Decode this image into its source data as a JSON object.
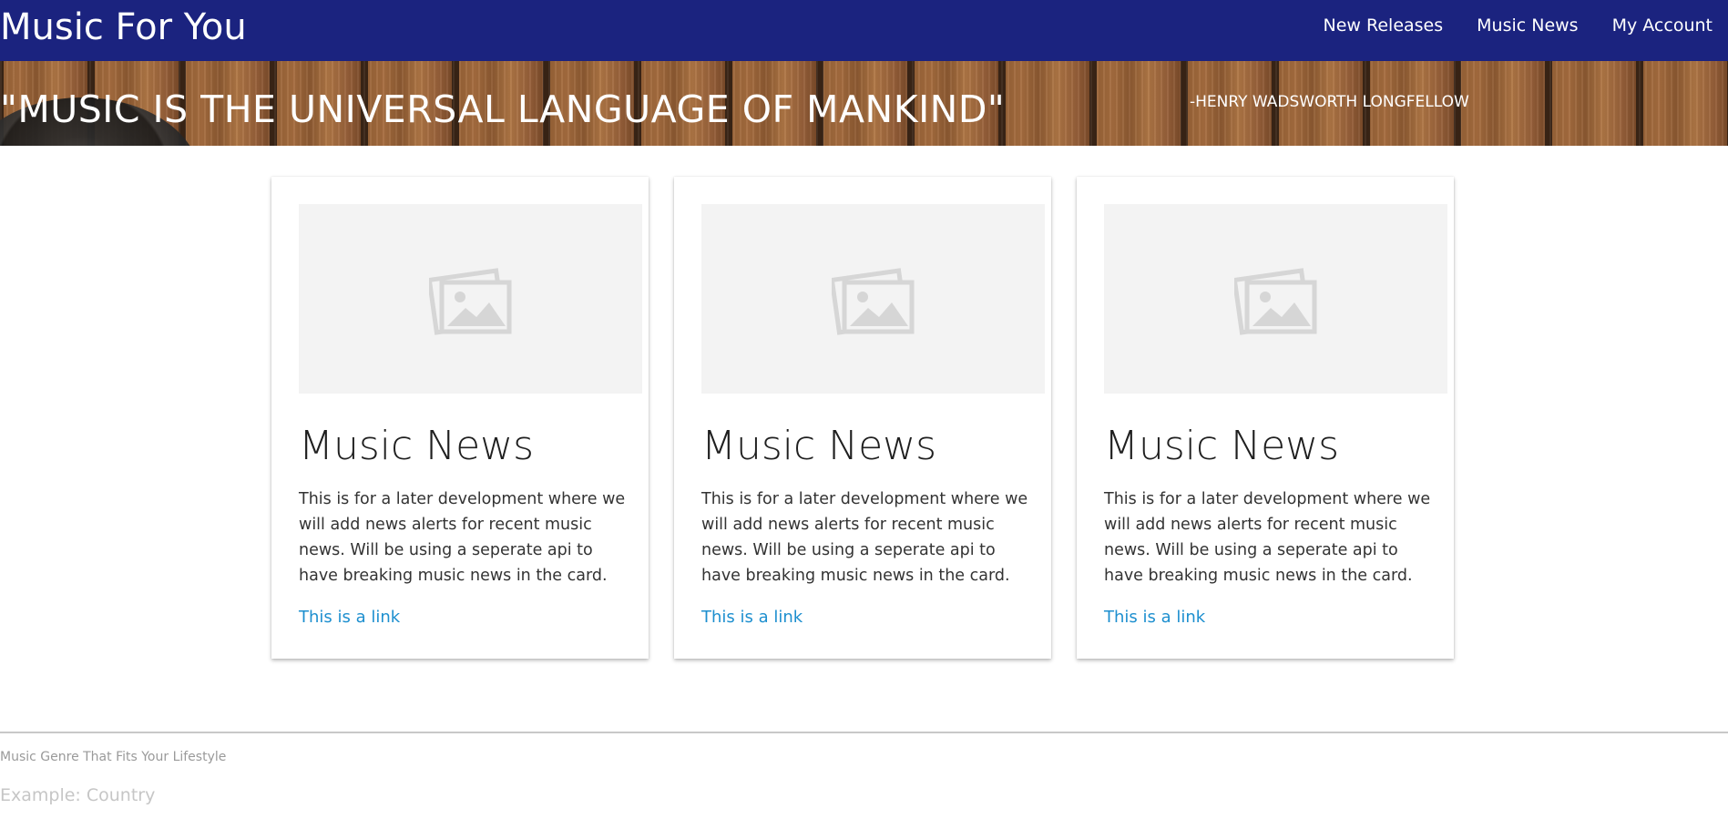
{
  "app": {
    "title": "Music For You"
  },
  "nav": {
    "links": [
      {
        "label": "New Releases"
      },
      {
        "label": "Music News"
      },
      {
        "label": "My Account"
      }
    ]
  },
  "hero": {
    "quote": "\"MUSIC IS THE UNIVERSAL LANGUAGE OF MANKIND\"",
    "author": "-HENRY WADSWORTH LONGFELLOW"
  },
  "cards": [
    {
      "image_icon": "image-placeholder-icon",
      "title": "Music News",
      "text": "This is for a later development where we will add news alerts for recent music news. Will be using a seperate api to have breaking music news in the card.",
      "link": "This is a link"
    },
    {
      "image_icon": "image-placeholder-icon",
      "title": "Music News",
      "text": "This is for a later development where we will add news alerts for recent music news. Will be using a seperate api to have breaking music news in the card.",
      "link": "This is a link"
    },
    {
      "image_icon": "image-placeholder-icon",
      "title": "Music News",
      "text": "This is for a later development where we will add news alerts for recent music news. Will be using a seperate api to have breaking music news in the card.",
      "link": "This is a link"
    }
  ],
  "footer": {
    "label": "Music Genre That Fits Your Lifestyle",
    "input_placeholder": "Example: Country",
    "input_value": ""
  },
  "colors": {
    "navbar": "#1b237f",
    "link": "#1d8fcf",
    "image_placeholder": "#f3f3f3"
  }
}
